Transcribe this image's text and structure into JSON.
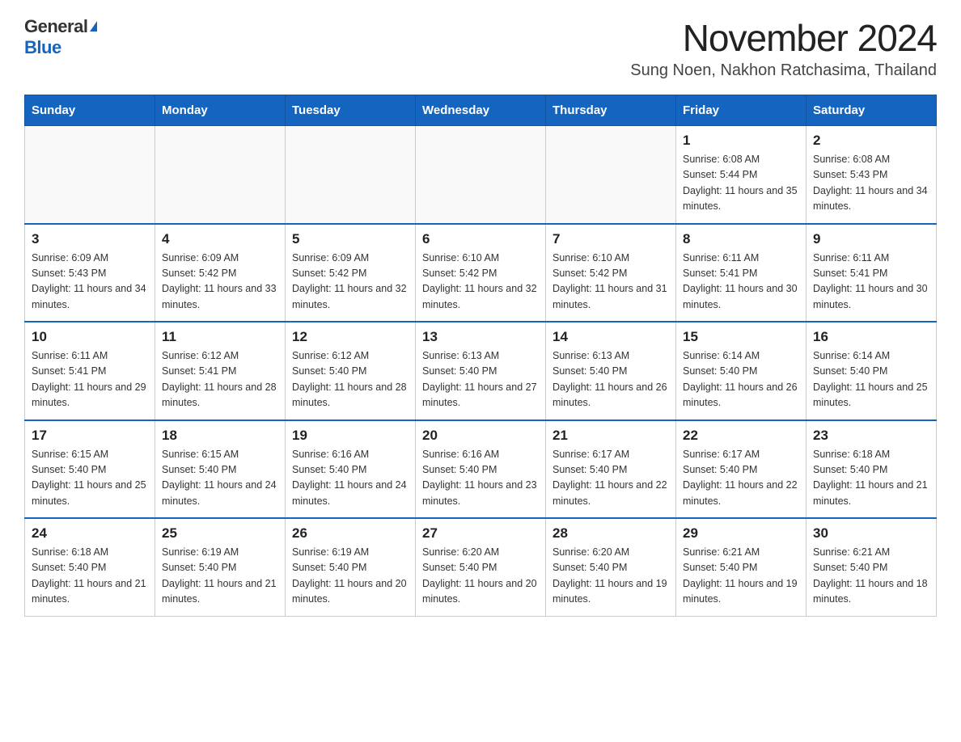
{
  "logo": {
    "general": "General",
    "blue": "Blue"
  },
  "title": {
    "month_year": "November 2024",
    "location": "Sung Noen, Nakhon Ratchasima, Thailand"
  },
  "days_of_week": [
    "Sunday",
    "Monday",
    "Tuesday",
    "Wednesday",
    "Thursday",
    "Friday",
    "Saturday"
  ],
  "weeks": [
    [
      {
        "day": "",
        "info": ""
      },
      {
        "day": "",
        "info": ""
      },
      {
        "day": "",
        "info": ""
      },
      {
        "day": "",
        "info": ""
      },
      {
        "day": "",
        "info": ""
      },
      {
        "day": "1",
        "info": "Sunrise: 6:08 AM\nSunset: 5:44 PM\nDaylight: 11 hours and 35 minutes."
      },
      {
        "day": "2",
        "info": "Sunrise: 6:08 AM\nSunset: 5:43 PM\nDaylight: 11 hours and 34 minutes."
      }
    ],
    [
      {
        "day": "3",
        "info": "Sunrise: 6:09 AM\nSunset: 5:43 PM\nDaylight: 11 hours and 34 minutes."
      },
      {
        "day": "4",
        "info": "Sunrise: 6:09 AM\nSunset: 5:42 PM\nDaylight: 11 hours and 33 minutes."
      },
      {
        "day": "5",
        "info": "Sunrise: 6:09 AM\nSunset: 5:42 PM\nDaylight: 11 hours and 32 minutes."
      },
      {
        "day": "6",
        "info": "Sunrise: 6:10 AM\nSunset: 5:42 PM\nDaylight: 11 hours and 32 minutes."
      },
      {
        "day": "7",
        "info": "Sunrise: 6:10 AM\nSunset: 5:42 PM\nDaylight: 11 hours and 31 minutes."
      },
      {
        "day": "8",
        "info": "Sunrise: 6:11 AM\nSunset: 5:41 PM\nDaylight: 11 hours and 30 minutes."
      },
      {
        "day": "9",
        "info": "Sunrise: 6:11 AM\nSunset: 5:41 PM\nDaylight: 11 hours and 30 minutes."
      }
    ],
    [
      {
        "day": "10",
        "info": "Sunrise: 6:11 AM\nSunset: 5:41 PM\nDaylight: 11 hours and 29 minutes."
      },
      {
        "day": "11",
        "info": "Sunrise: 6:12 AM\nSunset: 5:41 PM\nDaylight: 11 hours and 28 minutes."
      },
      {
        "day": "12",
        "info": "Sunrise: 6:12 AM\nSunset: 5:40 PM\nDaylight: 11 hours and 28 minutes."
      },
      {
        "day": "13",
        "info": "Sunrise: 6:13 AM\nSunset: 5:40 PM\nDaylight: 11 hours and 27 minutes."
      },
      {
        "day": "14",
        "info": "Sunrise: 6:13 AM\nSunset: 5:40 PM\nDaylight: 11 hours and 26 minutes."
      },
      {
        "day": "15",
        "info": "Sunrise: 6:14 AM\nSunset: 5:40 PM\nDaylight: 11 hours and 26 minutes."
      },
      {
        "day": "16",
        "info": "Sunrise: 6:14 AM\nSunset: 5:40 PM\nDaylight: 11 hours and 25 minutes."
      }
    ],
    [
      {
        "day": "17",
        "info": "Sunrise: 6:15 AM\nSunset: 5:40 PM\nDaylight: 11 hours and 25 minutes."
      },
      {
        "day": "18",
        "info": "Sunrise: 6:15 AM\nSunset: 5:40 PM\nDaylight: 11 hours and 24 minutes."
      },
      {
        "day": "19",
        "info": "Sunrise: 6:16 AM\nSunset: 5:40 PM\nDaylight: 11 hours and 24 minutes."
      },
      {
        "day": "20",
        "info": "Sunrise: 6:16 AM\nSunset: 5:40 PM\nDaylight: 11 hours and 23 minutes."
      },
      {
        "day": "21",
        "info": "Sunrise: 6:17 AM\nSunset: 5:40 PM\nDaylight: 11 hours and 22 minutes."
      },
      {
        "day": "22",
        "info": "Sunrise: 6:17 AM\nSunset: 5:40 PM\nDaylight: 11 hours and 22 minutes."
      },
      {
        "day": "23",
        "info": "Sunrise: 6:18 AM\nSunset: 5:40 PM\nDaylight: 11 hours and 21 minutes."
      }
    ],
    [
      {
        "day": "24",
        "info": "Sunrise: 6:18 AM\nSunset: 5:40 PM\nDaylight: 11 hours and 21 minutes."
      },
      {
        "day": "25",
        "info": "Sunrise: 6:19 AM\nSunset: 5:40 PM\nDaylight: 11 hours and 21 minutes."
      },
      {
        "day": "26",
        "info": "Sunrise: 6:19 AM\nSunset: 5:40 PM\nDaylight: 11 hours and 20 minutes."
      },
      {
        "day": "27",
        "info": "Sunrise: 6:20 AM\nSunset: 5:40 PM\nDaylight: 11 hours and 20 minutes."
      },
      {
        "day": "28",
        "info": "Sunrise: 6:20 AM\nSunset: 5:40 PM\nDaylight: 11 hours and 19 minutes."
      },
      {
        "day": "29",
        "info": "Sunrise: 6:21 AM\nSunset: 5:40 PM\nDaylight: 11 hours and 19 minutes."
      },
      {
        "day": "30",
        "info": "Sunrise: 6:21 AM\nSunset: 5:40 PM\nDaylight: 11 hours and 18 minutes."
      }
    ]
  ]
}
